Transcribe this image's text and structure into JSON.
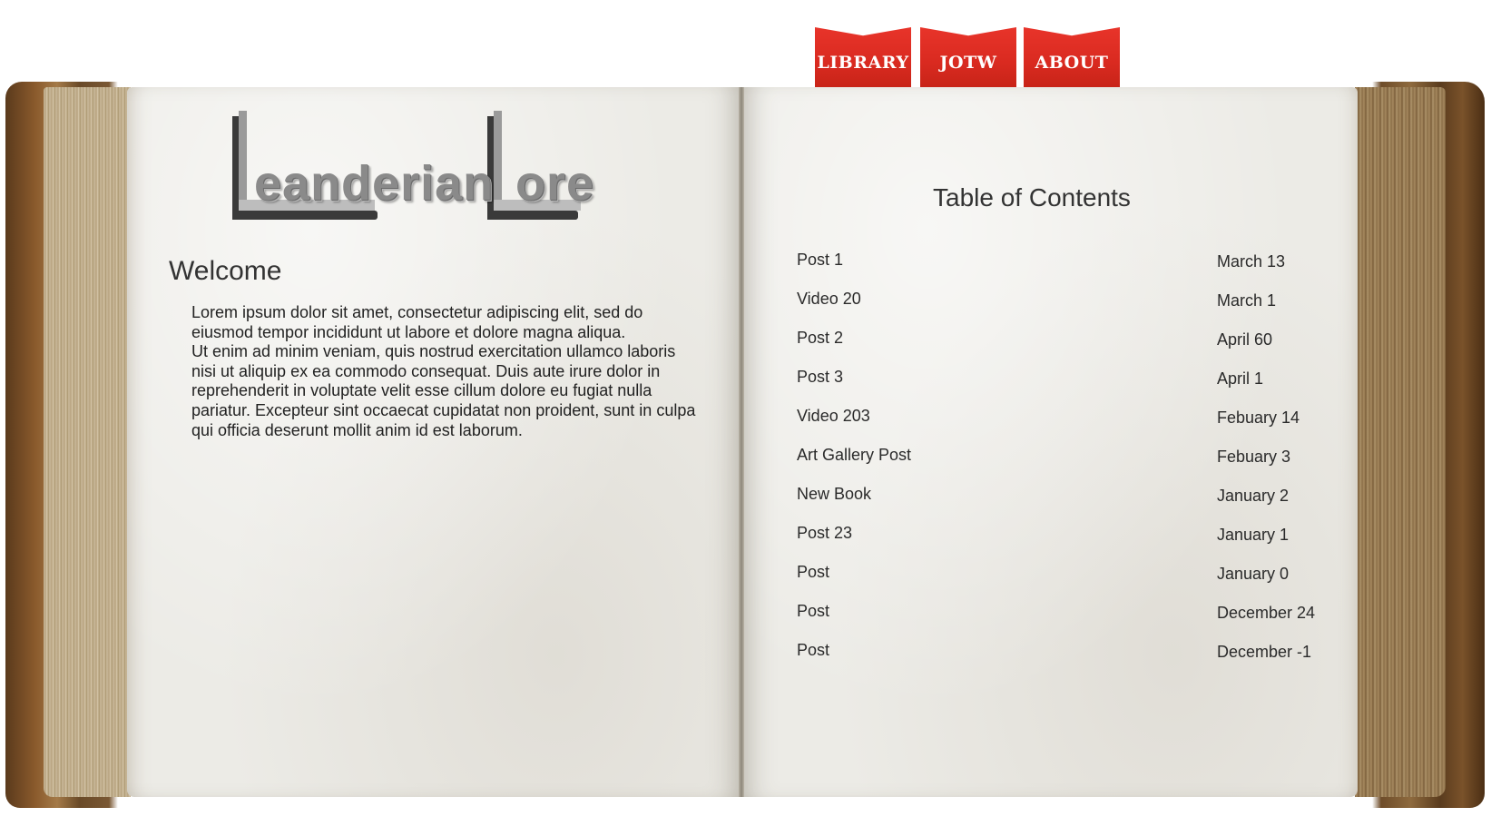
{
  "nav": {
    "tabs": [
      {
        "label": "LIBRARY"
      },
      {
        "label": "JOTW"
      },
      {
        "label": "ABOUT"
      }
    ],
    "tab_color": "#d92a20"
  },
  "logo": {
    "word_1": "eanderian",
    "word_2": "ore",
    "letter_1": "L",
    "letter_2": "L"
  },
  "welcome": {
    "title": "Welcome",
    "paragraph_1": "Lorem ipsum dolor sit amet, consectetur adipiscing elit, sed do eiusmod tempor incididunt ut labore et dolore magna aliqua.",
    "paragraph_2": "Ut enim ad minim veniam, quis nostrud exercitation ullamco laboris nisi ut aliquip ex ea commodo consequat. Duis aute irure dolor in reprehenderit in voluptate velit esse cillum dolore eu fugiat nulla pariatur. Excepteur sint occaecat cupidatat non proident, sunt in culpa qui officia deserunt mollit anim id est laborum."
  },
  "toc": {
    "title": "Table of Contents",
    "items": [
      {
        "post": "Post 1",
        "date": "March 13"
      },
      {
        "post": "Video 20",
        "date": "March 1"
      },
      {
        "post": "Post 2",
        "date": "April 60"
      },
      {
        "post": "Post 3",
        "date": "April 1"
      },
      {
        "post": "Video 203",
        "date": "Febuary 14"
      },
      {
        "post": "Art Gallery Post",
        "date": "Febuary 3"
      },
      {
        "post": "New Book",
        "date": "January 2"
      },
      {
        "post": "Post 23",
        "date": "January 1"
      },
      {
        "post": "Post",
        "date": "January 0"
      },
      {
        "post": "Post",
        "date": "December 24"
      },
      {
        "post": "Post",
        "date": "December -1"
      }
    ]
  }
}
